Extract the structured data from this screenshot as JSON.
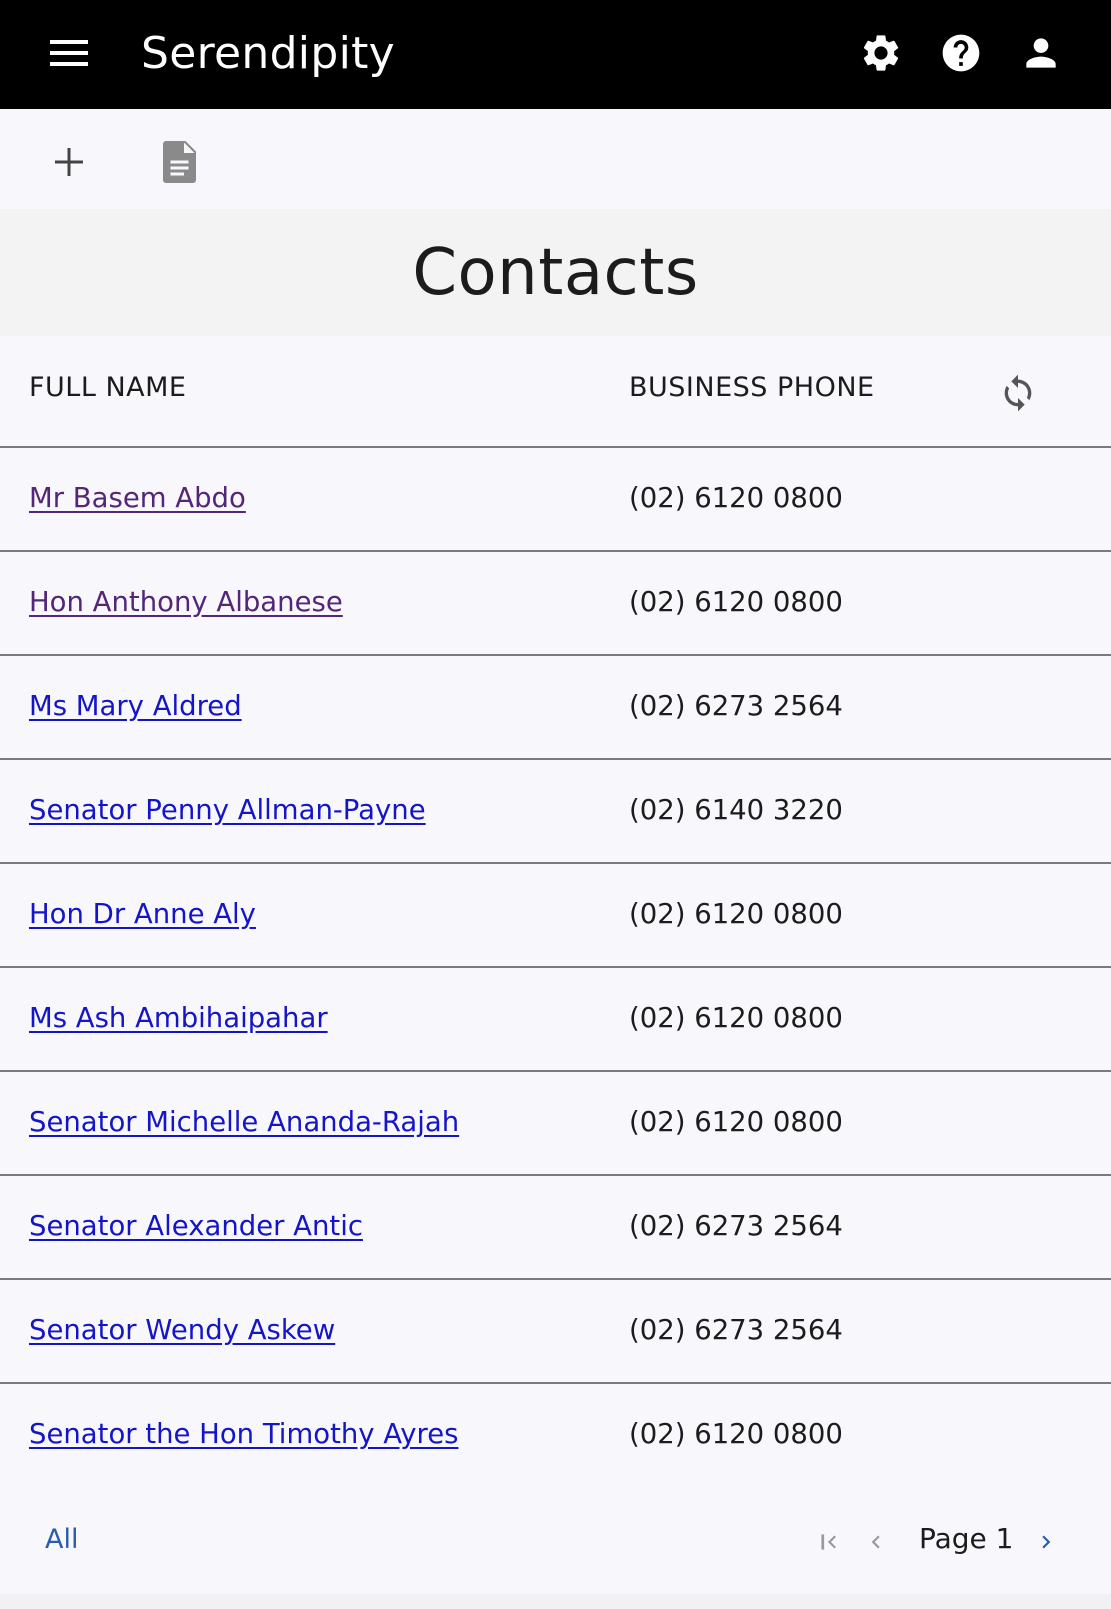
{
  "app": {
    "title": "Serendipity"
  },
  "icons": {
    "menu": "menu-icon",
    "settings": "gear-icon",
    "help": "help-circle-icon",
    "account": "person-icon",
    "add": "plus-icon",
    "document": "document-icon",
    "refresh": "refresh-icon",
    "first_page": "first-page-icon",
    "prev_page": "chevron-left-icon",
    "next_page": "chevron-right-icon"
  },
  "page": {
    "title": "Contacts"
  },
  "grid": {
    "columns": [
      "FULL NAME",
      "BUSINESS PHONE"
    ],
    "rows": [
      {
        "name": "Mr Basem Abdo",
        "phone": "(02) 6120 0800",
        "visited": true
      },
      {
        "name": "Hon Anthony Albanese",
        "phone": "(02) 6120 0800",
        "visited": true
      },
      {
        "name": "Ms Mary Aldred",
        "phone": "(02) 6273 2564",
        "visited": false
      },
      {
        "name": "Senator Penny Allman-Payne",
        "phone": "(02) 6140 3220",
        "visited": false
      },
      {
        "name": "Hon Dr Anne Aly",
        "phone": "(02) 6120 0800",
        "visited": false
      },
      {
        "name": "Ms Ash Ambihaipahar",
        "phone": "(02) 6120 0800",
        "visited": false
      },
      {
        "name": "Senator Michelle Ananda-Rajah",
        "phone": "(02) 6120 0800",
        "visited": false
      },
      {
        "name": "Senator Alexander Antic",
        "phone": "(02) 6273 2564",
        "visited": false
      },
      {
        "name": "Senator Wendy Askew",
        "phone": "(02) 6273 2564",
        "visited": false
      },
      {
        "name": "Senator the Hon Timothy Ayres",
        "phone": "(02) 6120 0800",
        "visited": false
      }
    ]
  },
  "footer": {
    "all_label": "All",
    "page_label": "Page 1"
  },
  "colors": {
    "app_bar": "#000000",
    "link": "#1515c8",
    "link_visited": "#53267a",
    "accent": "#2a5caa"
  }
}
